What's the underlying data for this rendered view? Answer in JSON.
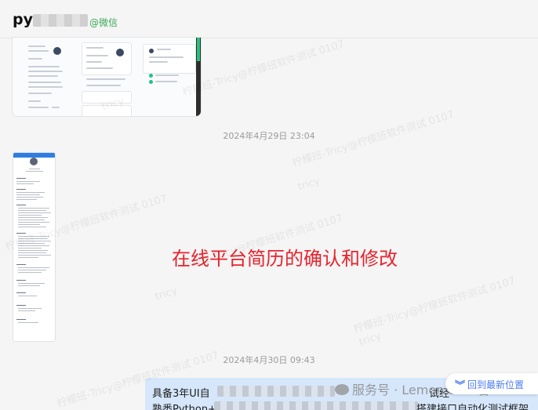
{
  "header": {
    "contact_name_prefix": "py",
    "source_tag": "@微信"
  },
  "messages": {
    "timestamp_1": "2024年4月29日 23:04",
    "caption": "在线平台简历的确认和修改",
    "timestamp_2": "2024年4月30日 09:43",
    "bubble_line_1_start": "具备3年UI自",
    "bubble_line_1_end": "试经",
    "bubble_line_2_start": "熟悉Python+",
    "bubble_line_2_end": "搭建接口自动化测试框架"
  },
  "overlay": {
    "official_account": "服务号 · Lemon offer官",
    "jump_latest_label": "回到最新位置"
  },
  "watermark_text": "柠檬班-Tricy@柠檬班软件测试 0107",
  "watermark_short": "tricy",
  "colors": {
    "accent_green": "#3aa855",
    "caption_red": "#e8232d",
    "bubble_blue": "#d6e7fb",
    "link_blue": "#4c7cf0"
  }
}
